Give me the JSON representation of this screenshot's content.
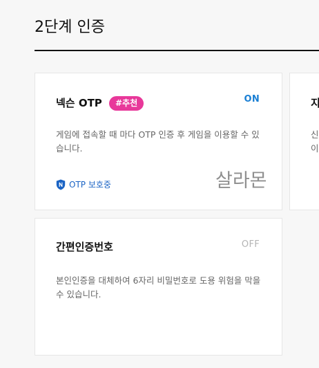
{
  "page": {
    "title": "2단계 인증"
  },
  "cards": {
    "otp": {
      "title": "넥슨 OTP",
      "tag": "#추천",
      "status": "ON",
      "description": "게임에 접속할 때 마다 OTP 인증 후 게임을 이용할 수 있습니다.",
      "protect_label": "OTP 보호중",
      "protect_icon": "shield-n-icon",
      "watermark": "살라몬"
    },
    "simple_auth": {
      "title": "간편인증번호",
      "status": "OFF",
      "description": "본인인증을 대체하여 6자리 비밀번호로 도용 위험을 막을 수 있습니다."
    },
    "partial": {
      "title": "지",
      "line1": "신",
      "line2": "이"
    }
  },
  "colors": {
    "on": "#1a7fd4",
    "off": "#b4b4b4",
    "tag": "#e8389a",
    "protect": "#1a63c4",
    "title_rule": "#111111"
  }
}
